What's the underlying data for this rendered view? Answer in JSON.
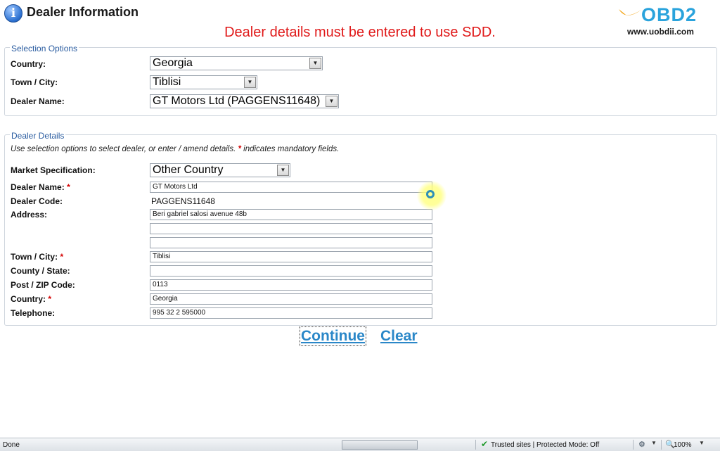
{
  "header": {
    "title": "Dealer Information",
    "warning": "Dealer details must be entered to use SDD.",
    "logo_text": "OBD2",
    "logo_url": "www.uobdii.com"
  },
  "selection": {
    "legend": "Selection Options",
    "country_label": "Country:",
    "country_value": "Georgia",
    "town_label": "Town / City:",
    "town_value": "Tiblisi",
    "dealer_label": "Dealer Name:",
    "dealer_value": "GT Motors Ltd (PAGGENS11648)"
  },
  "details": {
    "legend": "Dealer Details",
    "note": "Use selection options to select dealer, or enter / amend details.",
    "note_mandatory": "*",
    "note_tail": "indicates mandatory fields.",
    "market_label": "Market Specification:",
    "market_value": "Other Country",
    "name_label": "Dealer Name:",
    "name_value": "GT Motors Ltd",
    "code_label": "Dealer Code:",
    "code_value": "PAGGENS11648",
    "address_label": "Address:",
    "address_line1": "Beri gabriel salosi avenue 48b",
    "address_line2": "",
    "address_line3": "",
    "town_label": "Town / City:",
    "town_value": "Tiblisi",
    "county_label": "County / State:",
    "county_value": "",
    "zip_label": "Post / ZIP Code:",
    "zip_value": "0113",
    "country_label": "Country:",
    "country_value": "Georgia",
    "phone_label": "Telephone:",
    "phone_value": "995 32 2 595000",
    "required_mark": "*"
  },
  "actions": {
    "continue_label": "Continue",
    "clear_label": "Clear"
  },
  "statusbar": {
    "status": "Done",
    "zone": "Trusted sites | Protected Mode: Off",
    "zoom": "100%"
  },
  "icons": {
    "info": "info-icon",
    "check": "check-icon",
    "dropdown": "chevron-down-icon"
  },
  "colors": {
    "warning": "#e01a1a",
    "link": "#2a87c8",
    "legend": "#2a5ca0",
    "required": "#d40000"
  }
}
